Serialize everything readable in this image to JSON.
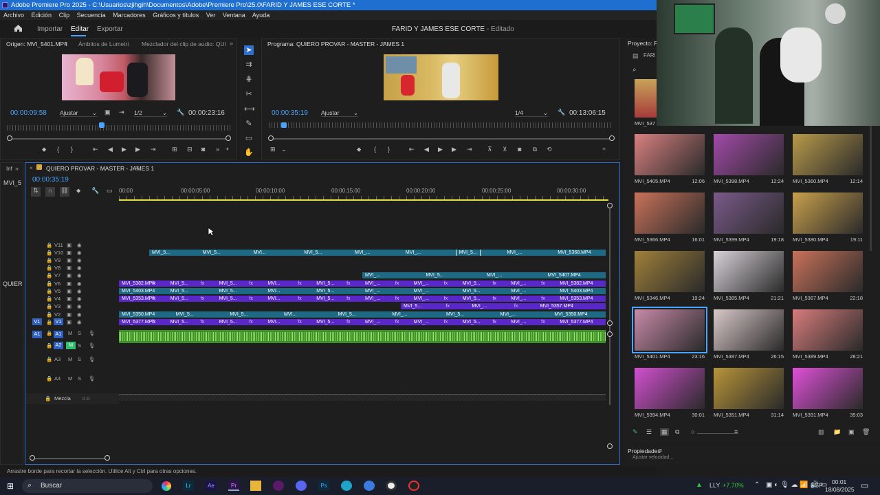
{
  "window": {
    "title": "Adobe Premiere Pro 2025 - C:\\Usuarios\\zjihgih\\Documentos\\Adobe\\Premiere Pro\\25.0\\FARID Y JAMES ESE CORTE *"
  },
  "menu": [
    "Archivo",
    "Edición",
    "Clip",
    "Secuencia",
    "Marcadores",
    "Gráficos y títulos",
    "Ver",
    "Ventana",
    "Ayuda"
  ],
  "header": {
    "nav": [
      "Importar",
      "Editar",
      "Exportar"
    ],
    "project_name": "FARID Y JAMES ESE CORTE",
    "project_state": " - Editado"
  },
  "source_monitor": {
    "tabs": [
      "Origen: MVI_5401.MP4",
      "Ámbitos de Lumetri",
      "Mezclador del clip de audio: QUIERO P"
    ],
    "timecode": "00:00:09:58",
    "fit": "Ajustar",
    "resolution": "1/2",
    "duration": "00:00:23:16",
    "playhead_fraction": 0.42
  },
  "program_monitor": {
    "tab": "Programa: QUIERO PROVAR - MASTER - JAMES 1",
    "timecode": "00:00:35:19",
    "fit": "Ajustar",
    "resolution": "1/4",
    "duration": "00:13:06:15"
  },
  "timeline": {
    "tab": "QUIERO PROVAR - MASTER - JAMES 1",
    "timecode": "00:00:35:19",
    "ruler": [
      "00:00",
      "00:00:05:00",
      "00:00:10:00",
      "00:00:15:00",
      "00:00:20:00",
      "00:00:25:00",
      "00:00:30:00"
    ],
    "video_tracks": [
      "V11",
      "V10",
      "V9",
      "V8",
      "V7",
      "V6",
      "V5",
      "V4",
      "V3",
      "V2",
      "V1"
    ],
    "audio_tracks": [
      "A1",
      "A2",
      "A3",
      "A4"
    ],
    "mix_label": "Mezcla",
    "mix_value": "0.0",
    "side_labels": [
      "Inf",
      "MVI_5",
      "QUIER"
    ],
    "clip_rows": [
      {
        "row": "V10",
        "type": "t",
        "labels": [
          "MVI_5...",
          "MVI_5...",
          "MVI...",
          "MVI_5...",
          "MVI_...",
          "MVI_...",
          "MVI_5...",
          "MVI_...",
          "MVI_5368.MP4"
        ]
      },
      {
        "row": "V7",
        "type": "t",
        "labels": [
          "MVI_...",
          "MVI_5...",
          "MVI_...",
          "MVI_5407.MP4"
        ]
      },
      {
        "row": "V6",
        "type": "v",
        "labels": [
          "MVI_5382.MP4",
          "MVI_5...",
          "MVI_5...",
          "MVI...",
          "MVI_5...",
          "MVI_...",
          "MVI_...",
          "MVI_5...",
          "MVI_...",
          "MVI_5382.MP4"
        ]
      },
      {
        "row": "V5",
        "type": "t",
        "labels": [
          "MVI_5403.MP4",
          "MVI_5...",
          "MVI_5...",
          "MVI...",
          "MVI_5...",
          "MVI_...",
          "MVI_...",
          "MVI_5...",
          "MVI_...",
          "MVI_5403.MP4"
        ]
      },
      {
        "row": "V4",
        "type": "v",
        "labels": [
          "MVI_5353.MP4",
          "MVI_5...",
          "MVI_5...",
          "MVI...",
          "MVI_5...",
          "MVI_...",
          "MVI_...",
          "MVI_5...",
          "MVI_...",
          "MVI_5353.MP4"
        ]
      },
      {
        "row": "V3",
        "type": "v",
        "labels": [
          "MVI_5...",
          "MVI_...",
          "MVI_5357.MP4"
        ]
      },
      {
        "row": "V2",
        "type": "t",
        "labels": [
          "MVI_5350.MP4",
          "MVI_5...",
          "MVI_5...",
          "MVI...",
          "MVI_5...",
          "MVI_...",
          "MVI_5...",
          "MVI_...",
          "MVI_5350.MP4"
        ]
      },
      {
        "row": "V1",
        "type": "v",
        "labels": [
          "MVI_5377.MP4",
          "MVI_5...",
          "MVI_5...",
          "MVI...",
          "MVI_5...",
          "MVI_...",
          "MVI_...",
          "MVI_5...",
          "MVI_...",
          "MVI_5377.MP4"
        ]
      }
    ]
  },
  "project": {
    "tab": "Proyecto: FA",
    "folder": "FARI",
    "first_item": "MVI_537",
    "items": [
      {
        "name": "MVI_5405.MP4",
        "duration": "12:06",
        "palette": "#d98080"
      },
      {
        "name": "MVI_5398.MP4",
        "duration": "12:24",
        "palette": "#a24aa8"
      },
      {
        "name": "MVI_5360.MP4",
        "duration": "12:14",
        "palette": "#b79a4a"
      },
      {
        "name": "MVI_5366.MP4",
        "duration": "16:01",
        "palette": "#c9725a"
      },
      {
        "name": "MVI_5399.MP4",
        "duration": "19:18",
        "palette": "#7a5a8a"
      },
      {
        "name": "MVI_5380.MP4",
        "duration": "19:11",
        "palette": "#c8a04c"
      },
      {
        "name": "MVI_5346.MP4",
        "duration": "19:24",
        "palette": "#a0803a"
      },
      {
        "name": "MVI_5385.MP4",
        "duration": "21:21",
        "palette": "#d8d2d8"
      },
      {
        "name": "MVI_5367.MP4",
        "duration": "22:18",
        "palette": "#c9725a"
      },
      {
        "name": "MVI_5401.MP4",
        "duration": "23:16",
        "palette": "#c88aa8"
      },
      {
        "name": "MVI_5387.MP4",
        "duration": "26:15",
        "palette": "#d9c8c8"
      },
      {
        "name": "MVI_5389.MP4",
        "duration": "28:21",
        "palette": "#d87c7c"
      },
      {
        "name": "MVI_5394.MP4",
        "duration": "30:01",
        "palette": "#d24fd0"
      },
      {
        "name": "MVI_5351.MP4",
        "duration": "31:14",
        "palette": "#b8943a"
      },
      {
        "name": "MVI_5391.MP4",
        "duration": "35:03",
        "palette": "#e050d8"
      }
    ],
    "properties_tab": "Propiedades",
    "properties_line": "Ajustar velocidad..."
  },
  "status_bar": "Arrastre borde para recortar la selección. Utilice Alt y Ctrl para otras opciones.",
  "taskbar": {
    "search": "Buscar",
    "stock": "LLY",
    "stock_change": "+7.70%",
    "lang": "ESP",
    "time": "00:01",
    "date": "18/08/2025"
  },
  "colors": {
    "accent": "#4aa3ff",
    "titlebar": "#1f6fd1",
    "clip_purple": "#5a28c8",
    "clip_teal": "#1e6a84",
    "audio_green": "#3f8f2c",
    "playhead": "#e3e33a"
  }
}
